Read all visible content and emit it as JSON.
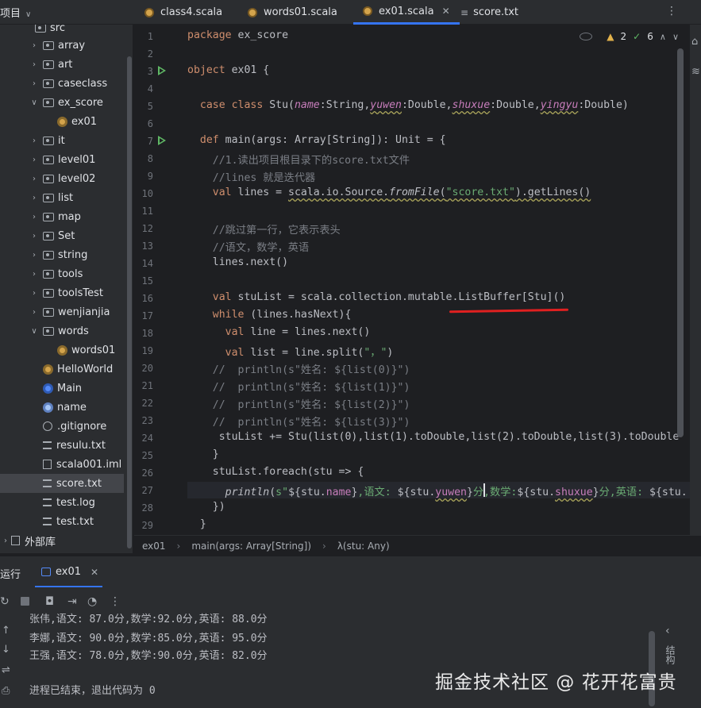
{
  "header": {
    "project_label": "项目",
    "tabs": [
      {
        "label": "class4.scala",
        "active": false
      },
      {
        "label": "words01.scala",
        "active": false
      },
      {
        "label": "ex01.scala",
        "active": true
      },
      {
        "label": "score.txt",
        "active": false
      }
    ]
  },
  "sidebar": {
    "top_partial": "src",
    "items": [
      {
        "label": "array",
        "type": "folder",
        "expanded": false
      },
      {
        "label": "art",
        "type": "folder",
        "expanded": false
      },
      {
        "label": "caseclass",
        "type": "folder",
        "expanded": false
      },
      {
        "label": "ex_score",
        "type": "folder",
        "expanded": true
      },
      {
        "label": "ex01",
        "type": "object"
      },
      {
        "label": "it",
        "type": "folder",
        "expanded": false
      },
      {
        "label": "level01",
        "type": "folder",
        "expanded": false
      },
      {
        "label": "level02",
        "type": "folder",
        "expanded": false
      },
      {
        "label": "list",
        "type": "folder",
        "expanded": false
      },
      {
        "label": "map",
        "type": "folder",
        "expanded": false
      },
      {
        "label": "Set",
        "type": "folder",
        "expanded": false
      },
      {
        "label": "string",
        "type": "folder",
        "expanded": false
      },
      {
        "label": "tools",
        "type": "folder",
        "expanded": false
      },
      {
        "label": "toolsTest",
        "type": "folder",
        "expanded": false
      },
      {
        "label": "wenjianjia",
        "type": "folder",
        "expanded": false
      },
      {
        "label": "words",
        "type": "folder",
        "expanded": true
      },
      {
        "label": "words01",
        "type": "object"
      },
      {
        "label": "HelloWorld",
        "type": "object"
      },
      {
        "label": "Main",
        "type": "class"
      },
      {
        "label": "name",
        "type": "class2"
      },
      {
        "label": ".gitignore",
        "type": "ignore"
      },
      {
        "label": "resulu.txt",
        "type": "lines"
      },
      {
        "label": "scala001.iml",
        "type": "file"
      },
      {
        "label": "score.txt",
        "type": "lines",
        "selected": true
      },
      {
        "label": "test.log",
        "type": "lines"
      },
      {
        "label": "test.txt",
        "type": "lines"
      },
      {
        "label": "外部库",
        "type": "library"
      }
    ]
  },
  "editor": {
    "inspections": {
      "warnings": "2",
      "ok": "6"
    },
    "line_numbers": [
      "1",
      "2",
      "3",
      "4",
      "5",
      "6",
      "7",
      "8",
      "9",
      "10",
      "11",
      "12",
      "13",
      "14",
      "15",
      "16",
      "17",
      "18",
      "19",
      "20",
      "21",
      "22",
      "23",
      "24",
      "25",
      "26",
      "27",
      "28",
      "29"
    ],
    "code": {
      "l1_kw": "package",
      "l1_rest": " ex_score",
      "l3_kw": "object",
      "l3_rest": " ex01 {",
      "l5_kw": "  case class",
      "l5_a": " Stu(",
      "l5_p1": "name",
      "l5_b": ":String,",
      "l5_p2": "yuwen",
      "l5_c": ":Double,",
      "l5_p3": "shuxue",
      "l5_d": ":Double,",
      "l5_p4": "yingyu",
      "l5_e": ":Double)",
      "l7_kw": "  def",
      "l7_rest": " main(args: Array[String]): Unit = {",
      "l8": "    //1.读出项目根目录下的score.txt文件",
      "l9": "    //lines 就是迭代器",
      "l10_kw": "    val",
      "l10_a": " lines = ",
      "l10_w": "scala.io.Source.",
      "l10_fn": "fromFile",
      "l10_b": "(",
      "l10_str": "\"score.txt\"",
      "l10_c": ").getLines()",
      "l12": "    //跳过第一行，它表示表头",
      "l13": "    //语文，数学，英语",
      "l14": "    lines.next()",
      "l16_kw": "    val",
      "l16_rest": " stuList = scala.collection.mutable.ListBuffer[Stu]()",
      "l17_kw": "    while",
      "l17_rest": " (lines.hasNext){",
      "l18_kw": "      val",
      "l18_rest": " line = lines.next()",
      "l19_kw": "      val",
      "l19_a": " list = line.split(",
      "l19_str": "\"，\"",
      "l19_b": ")",
      "l20": "    //  println(s\"姓名: ${list(0)}\")",
      "l21": "    //  println(s\"姓名: ${list(1)}\")",
      "l22": "    //  println(s\"姓名: ${list(2)}\")",
      "l23": "    //  println(s\"姓名: ${list(3)}\")",
      "l24": "     stuList += Stu(list(0),list(1).toDouble,list(2).toDouble,list(3).toDouble",
      "l25": "    }",
      "l26": "    stuList.foreach(stu => {",
      "l27_fn": "      println",
      "l27_a": "(",
      "l27_s1": "s\"",
      "l27_b": "${stu.",
      "l27_p1": "name",
      "l27_c": "}",
      "l27_s2": ",语文: ",
      "l27_d": "${stu.",
      "l27_p2": "yuwen",
      "l27_e": "}",
      "l27_s3": "分,数学:",
      "l27_f": "${stu.",
      "l27_p3": "shuxue",
      "l27_g": "}",
      "l27_s4": "分,英语: ",
      "l27_h": "${stu.",
      "l28": "    })",
      "l29": "  }"
    }
  },
  "breadcrumb": {
    "items": [
      "ex01",
      "main(args: Array[String])",
      "λ(stu: Any)"
    ]
  },
  "run_panel": {
    "label": "运行",
    "tab": "ex01",
    "console_lines": [
      "张伟,语文: 87.0分,数学:92.0分,英语: 88.0分",
      "李娜,语文: 90.0分,数学:85.0分,英语: 95.0分",
      "王强,语文: 78.0分,数学:90.0分,英语: 82.0分",
      "",
      "进程已结束，退出代码为 0"
    ],
    "vertical_label": "结构"
  },
  "watermark": "掘金技术社区 @ 花开花富贵"
}
